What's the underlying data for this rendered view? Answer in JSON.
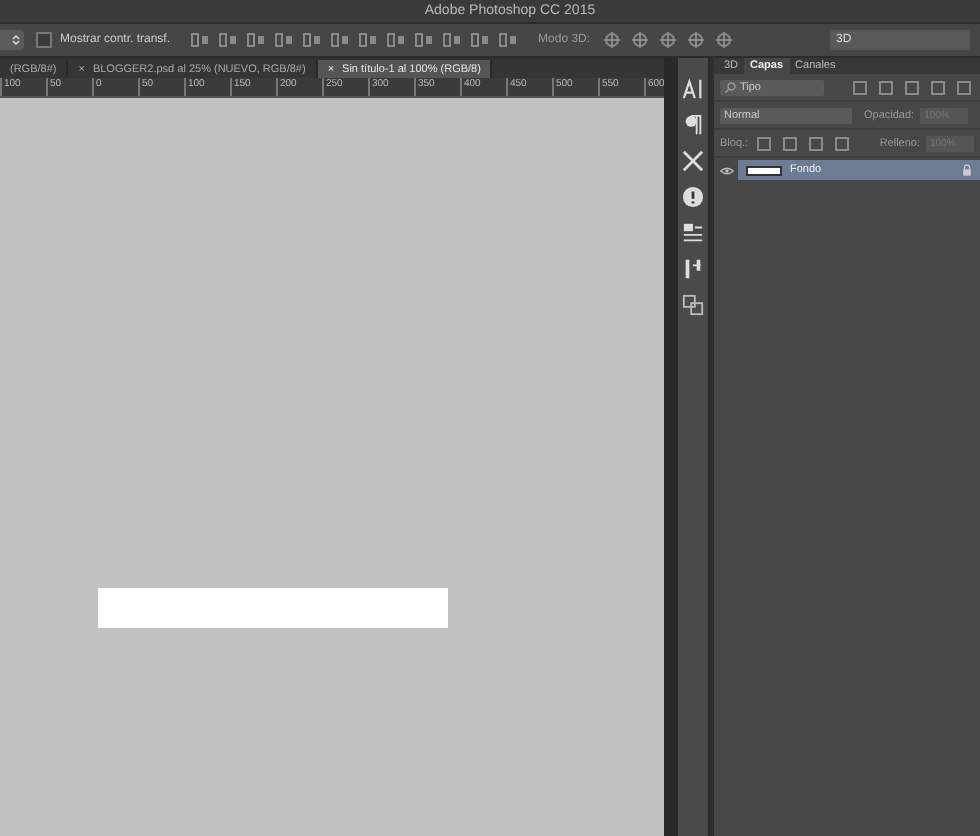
{
  "window": {
    "title": "Adobe Photoshop CC 2015"
  },
  "options_bar": {
    "transform_controls": {
      "label": "Mostrar contr. transf.",
      "checked": false
    },
    "mode_3d_label": "Modo 3D:",
    "workspace": "3D"
  },
  "document_tabs": [
    {
      "label": "(RGB/8#)",
      "selected": false
    },
    {
      "close": "×",
      "label": "BLOGGER2.psd al 25% (NUEVO, RGB/8#)",
      "selected": false
    },
    {
      "close": "×",
      "label": "Sin título-1 al 100% (RGB/8)",
      "selected": true
    }
  ],
  "ruler": [
    "100",
    "50",
    "0",
    "50",
    "100",
    "150",
    "200",
    "250",
    "300",
    "350",
    "400",
    "450",
    "500",
    "550",
    "600"
  ],
  "layers_panel": {
    "tabs": [
      {
        "label": "3D",
        "selected": false
      },
      {
        "label": "Capas",
        "selected": true
      },
      {
        "label": "Canales",
        "selected": false
      }
    ],
    "filter": "Tipo",
    "blend_mode": "Normal",
    "opacity_label": "Opacidad:",
    "opacity": "100%",
    "lock_label": "Bloq.:",
    "fill_label": "Relleno:",
    "fill": "100%",
    "layers": [
      {
        "name": "Fondo",
        "visible": true,
        "selected": true,
        "locked": true
      }
    ]
  }
}
